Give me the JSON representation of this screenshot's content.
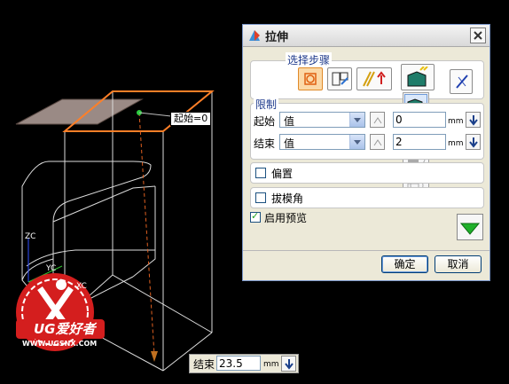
{
  "viewport": {
    "start_callout": "起始=0",
    "axis": {
      "zc": "ZC",
      "xc": "XC",
      "yc": "YC"
    }
  },
  "dialog": {
    "title": "拉伸",
    "close_icon": "close-icon",
    "step_group": {
      "label": "选择步骤"
    },
    "limits_group": {
      "label": "限制",
      "start": {
        "label": "起始",
        "type": "值",
        "value": "0",
        "unit": "mm"
      },
      "end": {
        "label": "结束",
        "type": "值",
        "value": "2",
        "unit": "mm"
      }
    },
    "offset": {
      "label": "偏置",
      "checked": false
    },
    "draft": {
      "label": "拔模角",
      "checked": false
    },
    "preview": {
      "label": "启用预览",
      "checked": true
    },
    "ok_label": "确定",
    "cancel_label": "取消"
  },
  "end_panel": {
    "label": "结束",
    "value": "23.5",
    "unit": "mm"
  },
  "watermark": {
    "text": "UG爱好者",
    "url": "WWW.UGSNX.COM"
  },
  "colors": {
    "accent_orange": "#ff7f27",
    "dialog_bg": "#ece9d8",
    "group_label": "#1e3a8c"
  }
}
